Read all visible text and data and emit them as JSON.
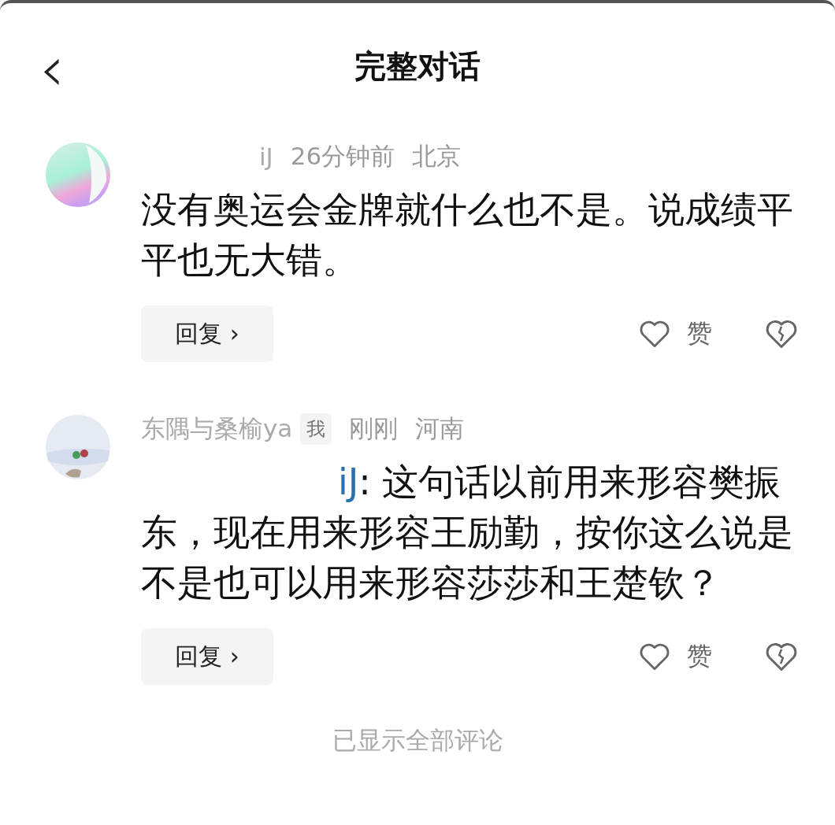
{
  "header": {
    "back": "‹",
    "title": "完整对话"
  },
  "comments": [
    {
      "author": "iJ",
      "time": "26分钟前",
      "location": "北京",
      "text": "没有奥运会金牌就什么也不是。说成绩平平也无大错。",
      "reply_label": "回复 ›",
      "like_label": "赞"
    },
    {
      "author": "东隅与桑榆ya",
      "author_tag": "我",
      "time": "刚刚",
      "location": "河南",
      "reply_to": "iJ",
      "text": ": 这句话以前用来形容樊振东，现在用来形容王励勤，按你这么说是不是也可以用来形容莎莎和王楚钦？",
      "reply_label": "回复 ›",
      "like_label": "赞"
    }
  ],
  "footer": "已显示全部评论"
}
